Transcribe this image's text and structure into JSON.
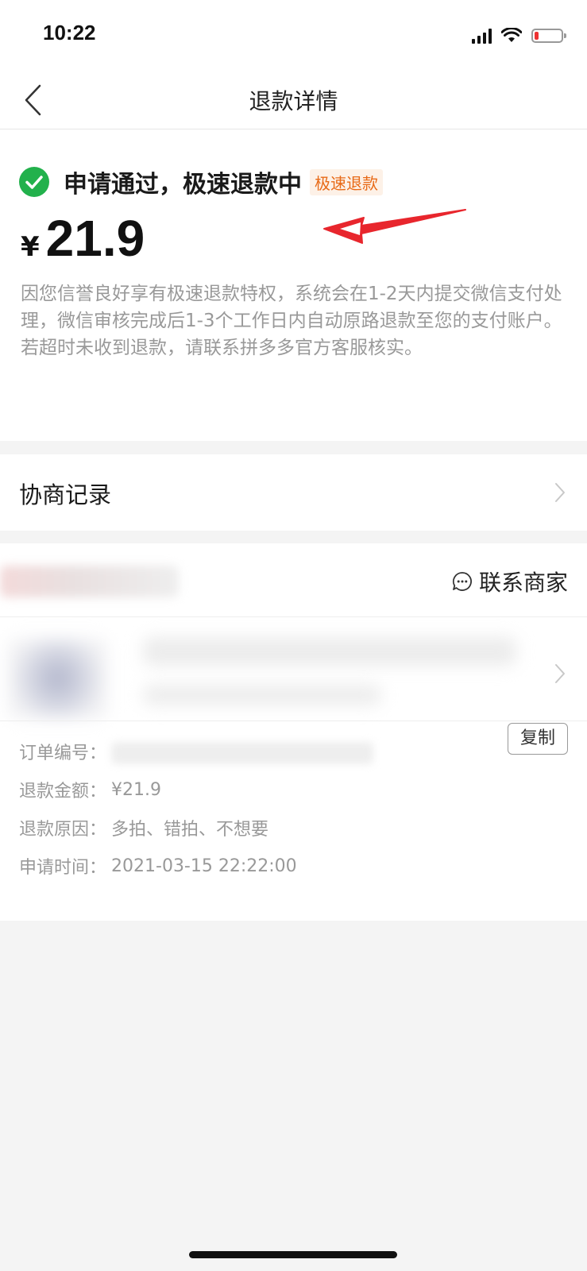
{
  "status_bar": {
    "time": "10:22"
  },
  "nav": {
    "title": "退款详情"
  },
  "refund_status": {
    "title": "申请通过，极速退款中",
    "tag": "极速退款",
    "currency_symbol": "¥",
    "amount": "21.9",
    "description": "因您信誉良好享有极速退款特权，系统会在1-2天内提交微信支付处理，微信审核完成后1-3个工作日内自动原路退款至您的支付账户。若超时未收到退款，请联系拼多多官方客服核实。"
  },
  "negotiation": {
    "label": "协商记录"
  },
  "order": {
    "contact_label": "联系商家",
    "copy_label": "复制",
    "order_number_label": "订单编号：",
    "refund_amount_label": "退款金额：",
    "refund_amount_value": "¥21.9",
    "refund_reason_label": "退款原因：",
    "refund_reason_value": "多拍、错拍、不想要",
    "apply_time_label": "申请时间：",
    "apply_time_value": "2021-03-15 22:22:00"
  },
  "colors": {
    "accent": "#e86a17",
    "success": "#22b14c",
    "annotation": "#e8262d"
  }
}
